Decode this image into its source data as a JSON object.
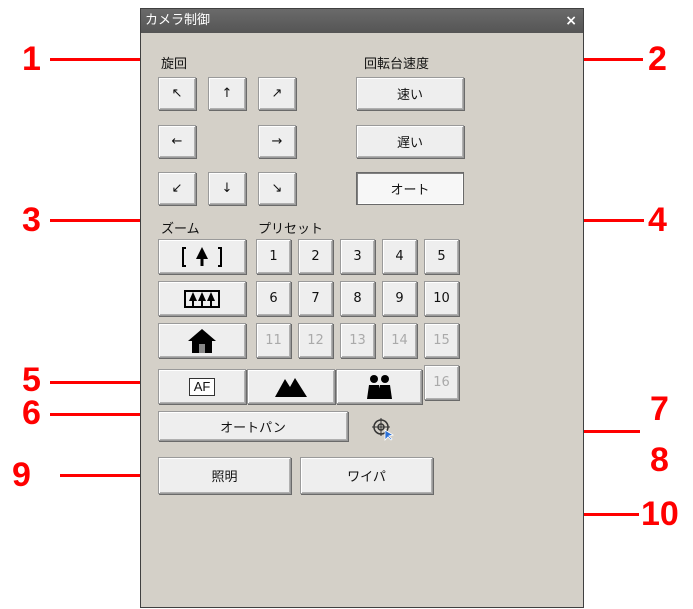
{
  "window": {
    "title": "カメラ制御",
    "close": "×"
  },
  "pan": {
    "label": "旋回",
    "arrows": [
      "↖",
      "↑",
      "↗",
      "←",
      "→",
      "↙",
      "↓",
      "↘"
    ]
  },
  "speed": {
    "label": "回転台速度",
    "fast": "速い",
    "slow": "遅い",
    "auto": "オート"
  },
  "zoom": {
    "label": "ズーム"
  },
  "preset": {
    "label": "プリセット",
    "buttons": [
      "1",
      "2",
      "3",
      "4",
      "5",
      "6",
      "7",
      "8",
      "9",
      "10",
      "11",
      "12",
      "13",
      "14",
      "15",
      "16"
    ]
  },
  "focus": {
    "af": "AF"
  },
  "autopan": {
    "label": "オートパン"
  },
  "lighting": {
    "label": "照明"
  },
  "wiper": {
    "label": "ワイパ"
  },
  "callouts": [
    "1",
    "2",
    "3",
    "4",
    "5",
    "6",
    "7",
    "8",
    "9",
    "10"
  ],
  "colors": {
    "callout": "#ff0000",
    "title_bar": "#5a5a5a",
    "panel": "#d4d0c8"
  }
}
